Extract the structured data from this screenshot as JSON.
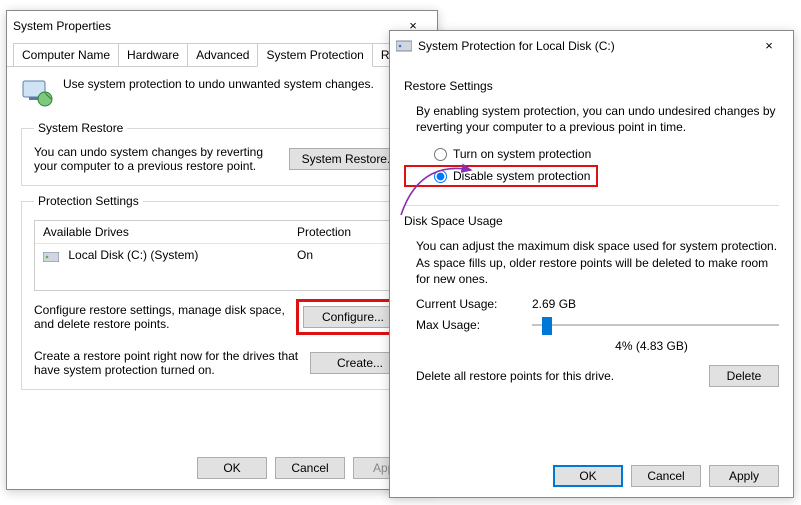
{
  "back": {
    "title": "System Properties",
    "close": "×",
    "tabs": [
      "Computer Name",
      "Hardware",
      "Advanced",
      "System Protection",
      "Remote"
    ],
    "active_tab_index": 3,
    "intro": "Use system protection to undo unwanted system changes.",
    "restore": {
      "legend": "System Restore",
      "desc": "You can undo system changes by reverting your computer to a previous restore point.",
      "button": "System Restore..."
    },
    "settings": {
      "legend": "Protection Settings",
      "col_drive": "Available Drives",
      "col_prot": "Protection",
      "drive_name": "Local Disk (C:) (System)",
      "drive_prot": "On",
      "configure_desc": "Configure restore settings, manage disk space, and delete restore points.",
      "configure_btn": "Configure...",
      "create_desc": "Create a restore point right now for the drives that have system protection turned on.",
      "create_btn": "Create..."
    },
    "footer": {
      "ok": "OK",
      "cancel": "Cancel",
      "apply": "Apply"
    }
  },
  "front": {
    "title": "System Protection for Local Disk (C:)",
    "close": "×",
    "restore": {
      "legend": "Restore Settings",
      "desc": "By enabling system protection, you can undo undesired changes by reverting your computer to a previous point in time.",
      "opt_on": "Turn on system protection",
      "opt_off": "Disable system protection",
      "selected": "off"
    },
    "usage": {
      "legend": "Disk Space Usage",
      "desc": "You can adjust the maximum disk space used for system protection. As space fills up, older restore points will be deleted to make room for new ones.",
      "current_label": "Current Usage:",
      "current_value": "2.69 GB",
      "max_label": "Max Usage:",
      "slider_percent": 4,
      "slider_text": "4% (4.83 GB)",
      "delete_desc": "Delete all restore points for this drive.",
      "delete_btn": "Delete"
    },
    "footer": {
      "ok": "OK",
      "cancel": "Cancel",
      "apply": "Apply"
    }
  }
}
